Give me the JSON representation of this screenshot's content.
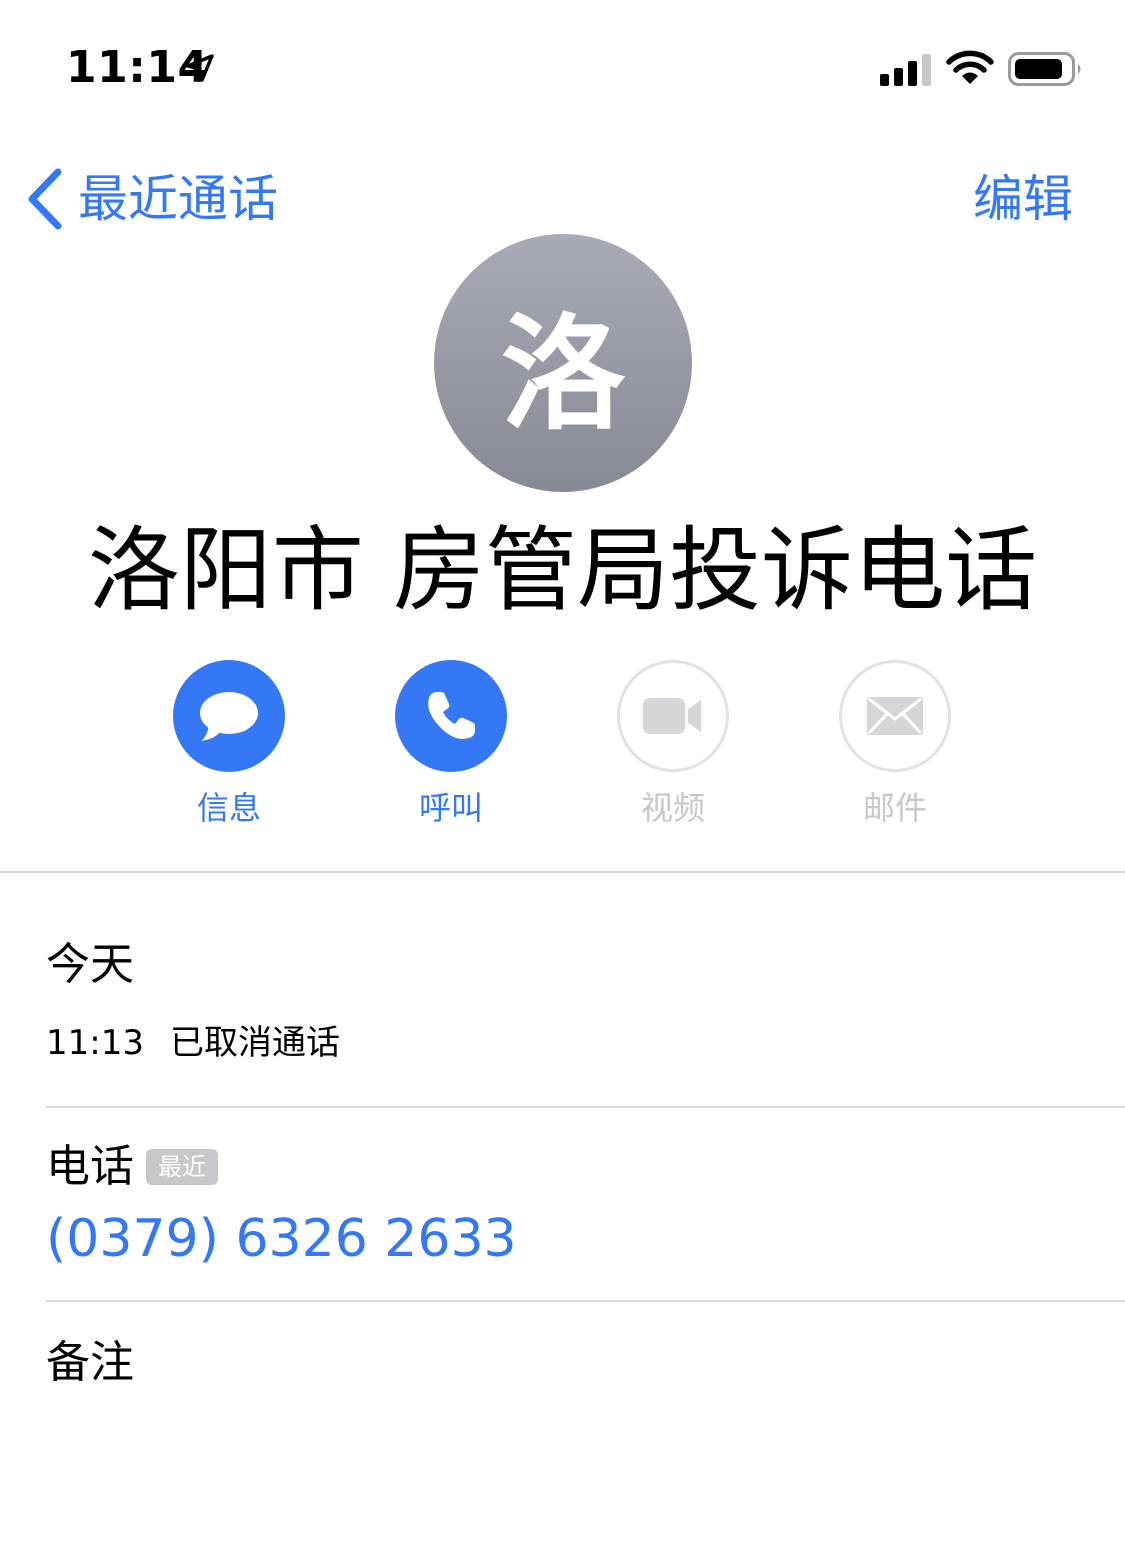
{
  "status_bar": {
    "time": "11:14",
    "icons": [
      "location-arrow-icon",
      "cellular-signal-icon",
      "wifi-icon",
      "battery-icon"
    ]
  },
  "nav": {
    "back_label": "最近通话",
    "edit_label": "编辑"
  },
  "contact": {
    "avatar_initial": "洛",
    "name": "洛阳市 房管局投诉电话"
  },
  "actions": [
    {
      "label": "信息",
      "icon": "message-bubble-icon",
      "enabled": true
    },
    {
      "label": "呼叫",
      "icon": "phone-icon",
      "enabled": true
    },
    {
      "label": "视频",
      "icon": "video-camera-icon",
      "enabled": false
    },
    {
      "label": "邮件",
      "icon": "mail-envelope-icon",
      "enabled": false
    }
  ],
  "recents": {
    "heading": "今天",
    "entries": [
      {
        "time": "11:13",
        "status": "已取消通话"
      }
    ]
  },
  "phone": {
    "label": "电话",
    "badge": "最近",
    "number": "(0379) 6326 2633"
  },
  "notes": {
    "label": "备注"
  },
  "colors": {
    "accent": "#3478f6",
    "disabled": "#c7c7cc",
    "divider": "#d8d8dc"
  }
}
